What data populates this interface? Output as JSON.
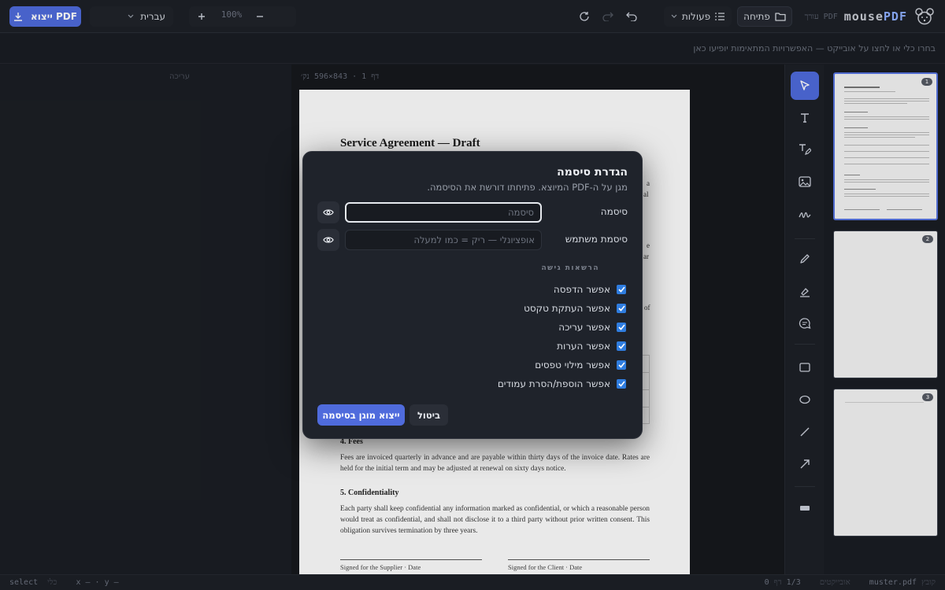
{
  "brand": {
    "name_a": "mouse",
    "name_b": "PDF",
    "subtitle": "עורך PDF"
  },
  "toolbar": {
    "open_label": "פתיחה",
    "actions_label": "פעולות",
    "zoom_value": "100%",
    "language_label": "עברית",
    "export_label": "ייצוא PDF"
  },
  "hint": "בחרו כלי או לחצו על אובייקט — האפשרויות המתאימות יופיעו כאן",
  "left_panel": {
    "placeholder": "עריכה"
  },
  "canvas": {
    "page_info": "דף 1 · 843×596 נק׳",
    "document": {
      "title": "Service Agreement — Draft",
      "fragments": [
        "a",
        "al",
        "e",
        "ar",
        "of"
      ],
      "section4_title": "4. Fees",
      "section4_text": "Fees are invoiced quarterly in advance and are payable within thirty days of the invoice date. Rates are held for the initial term and may be adjusted at renewal on sixty days notice.",
      "section5_title": "5. Confidentiality",
      "section5_text": "Each party shall keep confidential any information marked as confidential, or which a reasonable person would treat as confidential, and shall not disclose it to a third party without prior written consent. This obligation survives termination by three years.",
      "sig_supplier": "Signed for the Supplier · Date",
      "sig_client": "Signed for the Client · Date"
    }
  },
  "thumbnails": [
    {
      "number": "1",
      "selected": true
    },
    {
      "number": "2",
      "selected": false
    },
    {
      "number": "3",
      "selected": false
    }
  ],
  "tools": [
    "select-icon",
    "text-icon",
    "edit-text-icon",
    "image-icon",
    "signature-icon",
    "pen-icon",
    "highlighter-icon",
    "comment-icon",
    "rectangle-icon",
    "ellipse-icon",
    "line-icon",
    "arrow-icon",
    "redact-icon"
  ],
  "statusbar": {
    "tool_key": "כלי",
    "tool_value": "select",
    "coords": "x – · y –",
    "file_key": "קובץ",
    "file_value": "muster.pdf",
    "page_key": "דף",
    "page_value": "1/3",
    "objects_key": "אובייקטים",
    "objects_value": "0"
  },
  "dialog": {
    "title": "הגדרת סיסמה",
    "subtitle": "מגן על ה-PDF המיוצא. פתיחתו דורשת את הסיסמה.",
    "password_label": "סיסמה",
    "password_placeholder": "סיסמה",
    "password_value": "",
    "user_password_label": "סיסמת משתמש",
    "user_password_placeholder": "אופציונלי — ריק = כמו למעלה",
    "user_password_value": "",
    "permissions_heading": "הרשאות גישה",
    "permissions": [
      {
        "label": "אפשר הדפסה",
        "checked": true
      },
      {
        "label": "אפשר העתקת טקסט",
        "checked": true
      },
      {
        "label": "אפשר עריכה",
        "checked": true
      },
      {
        "label": "אפשר הערות",
        "checked": true
      },
      {
        "label": "אפשר מילוי טפסים",
        "checked": true
      },
      {
        "label": "אפשר הוספת/הסרת עמודים",
        "checked": true
      }
    ],
    "confirm_label": "ייצוא מוגן בסיסמה",
    "cancel_label": "ביטול"
  },
  "colors": {
    "accent": "#4f6bdc",
    "checkbox": "#2f7de0",
    "modal_bg": "#1f232b",
    "app_bg": "#1b1e24"
  }
}
